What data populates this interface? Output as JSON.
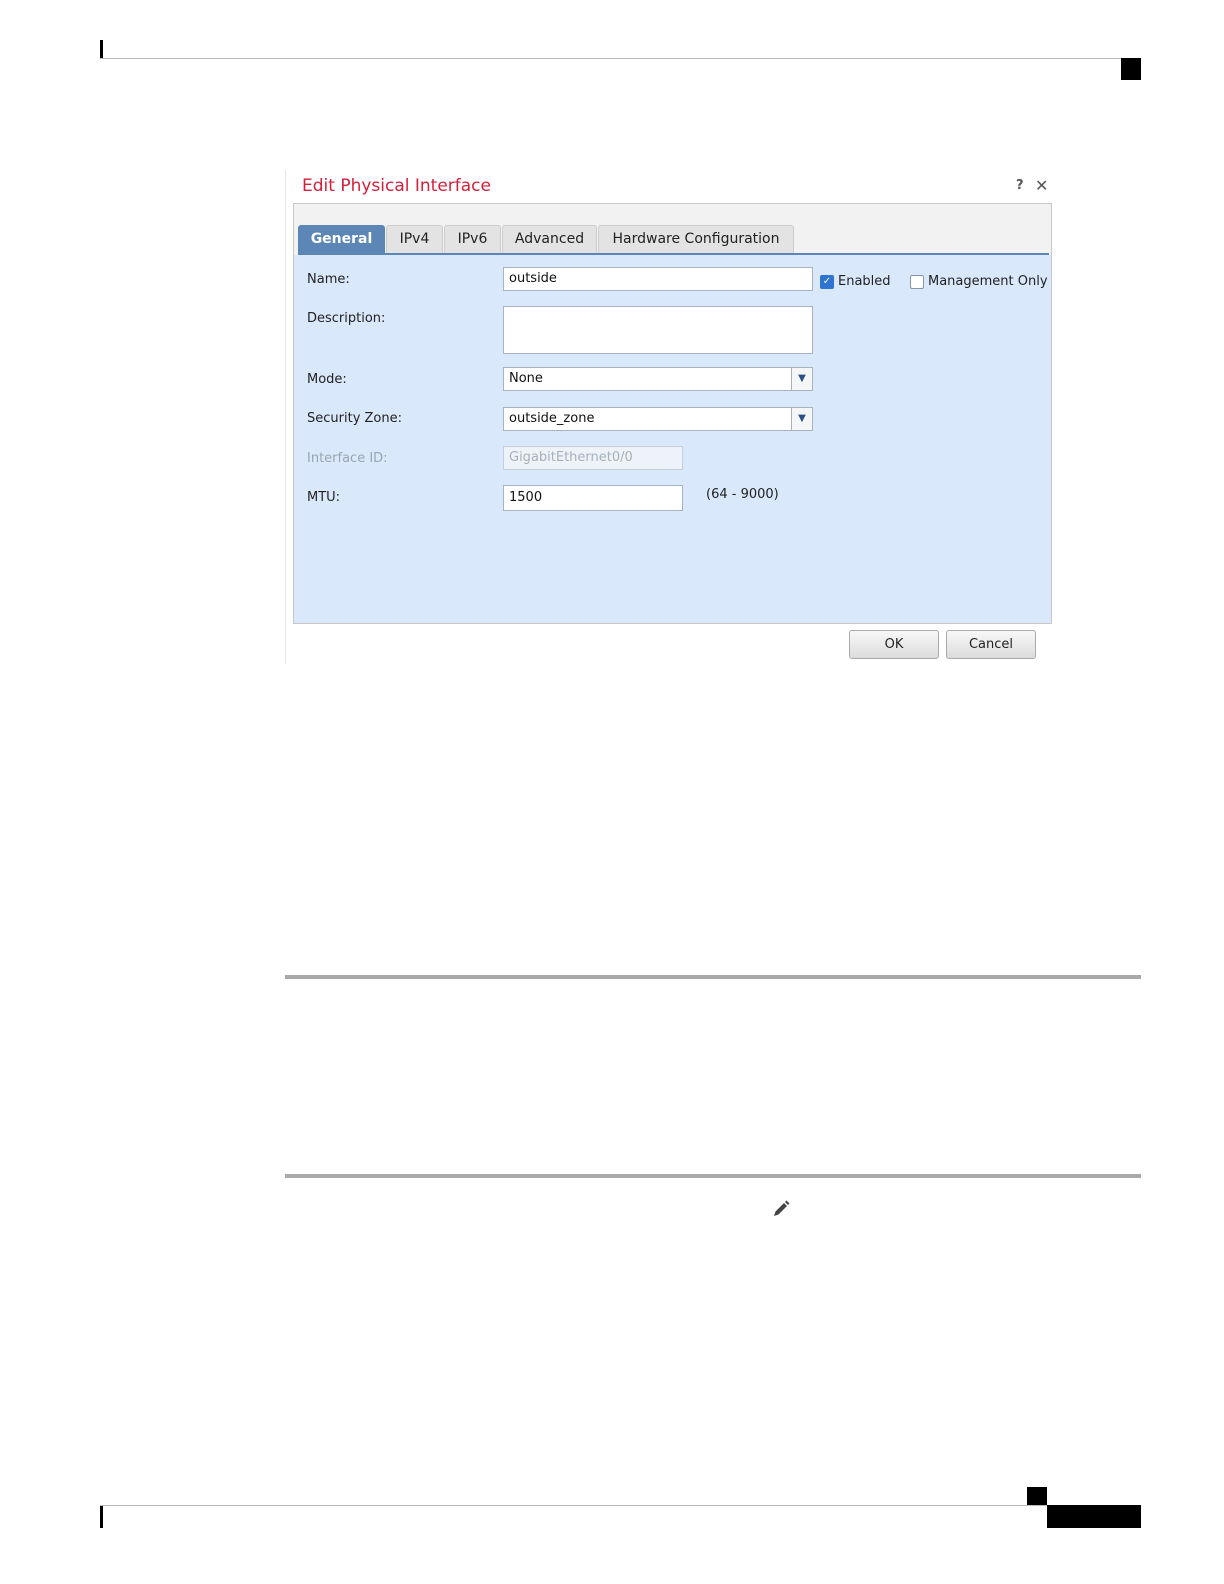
{
  "dialog": {
    "title": "Edit Physical Interface",
    "help": "?",
    "close": "✕",
    "tabs": [
      {
        "label": "General",
        "active": true
      },
      {
        "label": "IPv4",
        "active": false
      },
      {
        "label": "IPv6",
        "active": false
      },
      {
        "label": "Advanced",
        "active": false
      },
      {
        "label": "Hardware Configuration",
        "active": false
      }
    ],
    "fields": {
      "name_label": "Name:",
      "name_value": "outside",
      "enabled_label": "Enabled",
      "enabled_checked": true,
      "management_only_label": "Management Only",
      "management_only_checked": false,
      "description_label": "Description:",
      "description_value": "",
      "mode_label": "Mode:",
      "mode_value": "None",
      "security_zone_label": "Security Zone:",
      "security_zone_value": "outside_zone",
      "interface_id_label": "Interface ID:",
      "interface_id_value": "GigabitEthernet0/0",
      "mtu_label": "MTU:",
      "mtu_value": "1500",
      "mtu_range": "(64 - 9000)"
    },
    "buttons": {
      "ok": "OK",
      "cancel": "Cancel"
    }
  },
  "icons": {
    "dropdown": "chevron-down-icon",
    "check": "check-icon",
    "edit": "pencil-icon"
  },
  "colors": {
    "title": "#d31f3a",
    "tab_active": "#5b86b6",
    "panel": "#d9e8fb"
  }
}
